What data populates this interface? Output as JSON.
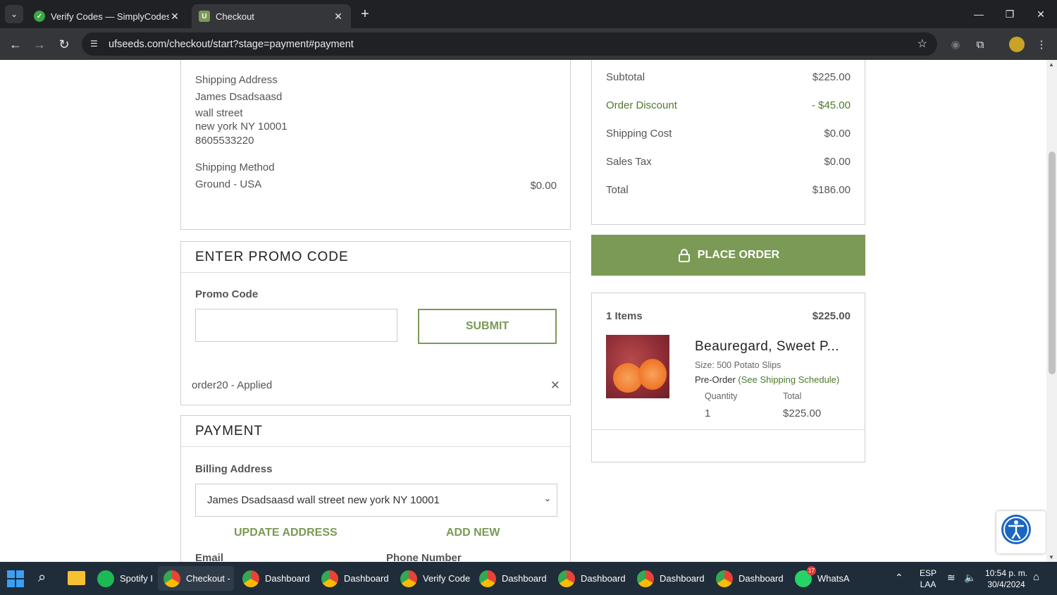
{
  "browser": {
    "tabs": [
      {
        "title": "Verify Codes — SimplyCodes",
        "icon": "simplycodes-icon"
      },
      {
        "title": "Checkout",
        "icon": "ufseeds-icon"
      }
    ],
    "url": "ufseeds.com/checkout/start?stage=payment#payment"
  },
  "shipping": {
    "address_label": "Shipping Address",
    "name": "James Dsadsaasd",
    "street": "wall street",
    "city": "new york NY 10001",
    "phone": "8605533220",
    "method_label": "Shipping Method",
    "method": "Ground - USA",
    "method_cost": "$0.00"
  },
  "promo": {
    "heading": "ENTER PROMO CODE",
    "label": "Promo Code",
    "input_value": "",
    "submit": "SUBMIT",
    "applied": "order20 - Applied"
  },
  "payment": {
    "heading": "PAYMENT",
    "billing_label": "Billing Address",
    "billing_selected": "James Dsadsaasd wall street new york NY 10001",
    "update": "UPDATE ADDRESS",
    "add_new": "ADD NEW",
    "email_label": "Email",
    "phone_label": "Phone Number"
  },
  "summary": {
    "subtotal_label": "Subtotal",
    "subtotal": "$225.00",
    "discount_label": "Order Discount",
    "discount": "- $45.00",
    "shipping_label": "Shipping Cost",
    "shipping": "$0.00",
    "tax_label": "Sales Tax",
    "tax": "$0.00",
    "total_label": "Total",
    "total": "$186.00"
  },
  "place_order": "PLACE ORDER",
  "cart": {
    "items_label": "1 Items",
    "items_total": "$225.00",
    "product_name": "Beauregard, Sweet P...",
    "size": "Size: 500 Potato Slips",
    "preorder": "Pre-Order",
    "schedule_link": "(See Shipping Schedule)",
    "qty_label": "Quantity",
    "qty": "1",
    "total_label": "Total",
    "line_total": "$225.00"
  },
  "taskbar": {
    "items": [
      "Spotify I",
      "Checkout -",
      "Dashboard",
      "Dashboard",
      "Verify Code",
      "Dashboard",
      "Dashboard",
      "Dashboard",
      "Dashboard",
      "WhatsA"
    ],
    "whatsapp_badge": "17",
    "lang": "ESP",
    "region": "LAA",
    "time": "10:54 p. m.",
    "date": "30/4/2024"
  },
  "colors": {
    "accent_green": "#7b9a55",
    "link_green": "#4e7a2c"
  }
}
